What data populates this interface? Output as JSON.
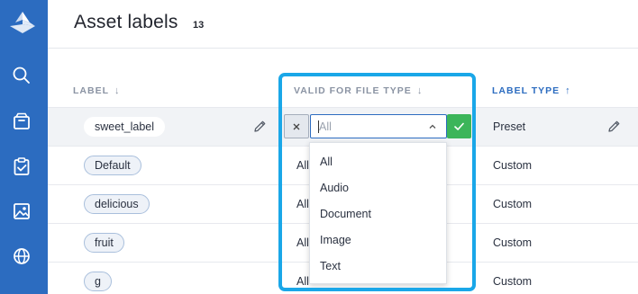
{
  "sidebar": {
    "icons": [
      "logo-icon",
      "search-icon",
      "inbox-icon",
      "clipboard-check-icon",
      "image-icon",
      "globe-icon"
    ]
  },
  "header": {
    "title": "Asset labels",
    "count": "13"
  },
  "table": {
    "columns": {
      "label": "LABEL",
      "valid": "VALID FOR FILE TYPE",
      "type": "LABEL TYPE"
    },
    "rows": [
      {
        "label": "sweet_label",
        "valid": "",
        "type": "Preset"
      },
      {
        "label": "Default",
        "valid": "All",
        "type": "Custom"
      },
      {
        "label": "delicious",
        "valid": "All",
        "type": "Custom"
      },
      {
        "label": "fruit",
        "valid": "All",
        "type": "Custom"
      },
      {
        "label": "g",
        "valid": "All",
        "type": "Custom"
      }
    ]
  },
  "editor": {
    "select_placeholder": "All",
    "options": [
      "All",
      "Audio",
      "Document",
      "Image",
      "Text"
    ]
  },
  "colors": {
    "sidebar": "#2c6cc0",
    "accent": "#2c6cc0",
    "confirm": "#3cb55a",
    "highlight": "#1aa7e8"
  }
}
